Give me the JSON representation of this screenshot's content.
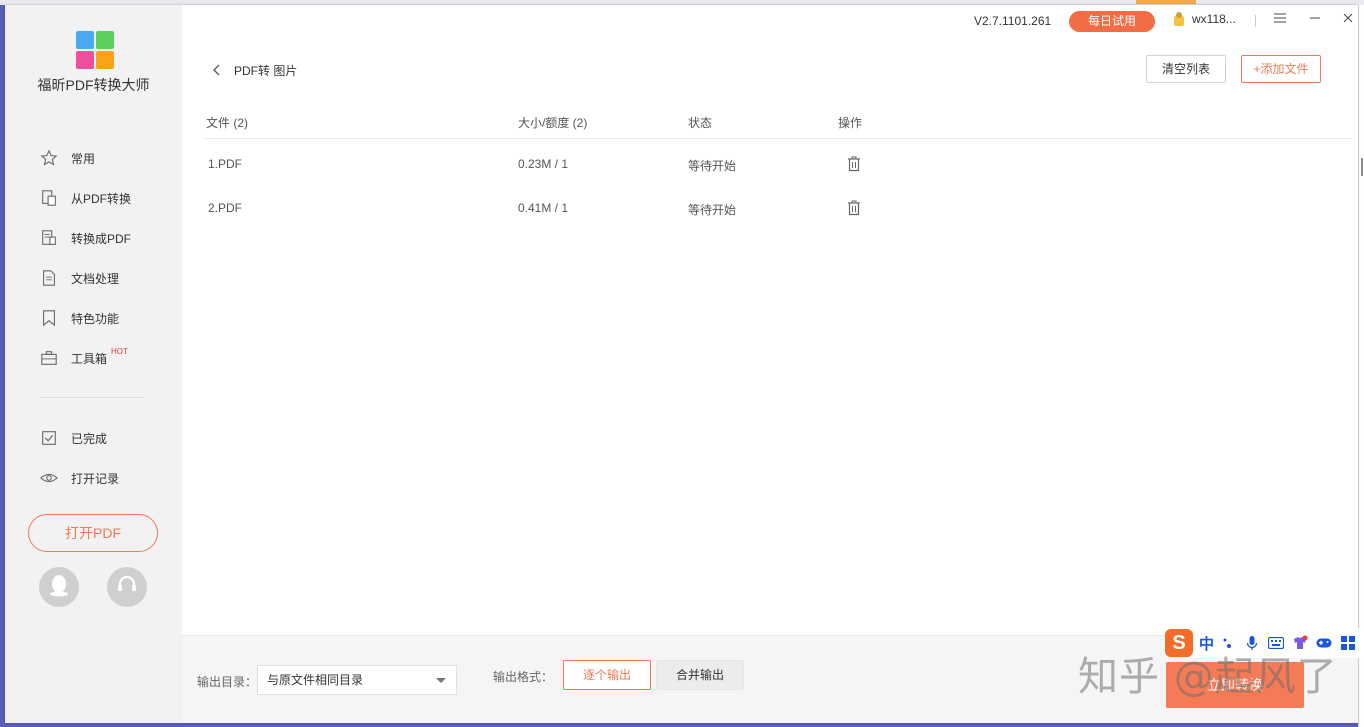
{
  "app": {
    "name": "福昕PDF转换大师",
    "version": "V2.7.1101.261",
    "trial_label": "每日试用",
    "username": "wx118..."
  },
  "sidebar": {
    "items": [
      {
        "label": "常用",
        "icon": "star-icon"
      },
      {
        "label": "从PDF转换",
        "icon": "pdf-convert-icon"
      },
      {
        "label": "转换成PDF",
        "icon": "to-pdf-icon"
      },
      {
        "label": "文档处理",
        "icon": "document-icon"
      },
      {
        "label": "特色功能",
        "icon": "bookmark-icon"
      },
      {
        "label": "工具箱",
        "icon": "toolbox-icon",
        "badge": "HOT"
      },
      {
        "label": "已完成",
        "icon": "check-icon"
      },
      {
        "label": "打开记录",
        "icon": "eye-icon"
      }
    ],
    "open_pdf_label": "打开PDF"
  },
  "main": {
    "breadcrumb": "PDF转 图片",
    "clear_list_label": "清空列表",
    "add_file_label": "+添加文件",
    "columns": {
      "file": "文件 (2)",
      "size": "大小/额度 (2)",
      "status": "状态",
      "action": "操作"
    },
    "rows": [
      {
        "file": "1.PDF",
        "size": "0.23M / 1",
        "status": "等待开始"
      },
      {
        "file": "2.PDF",
        "size": "0.41M / 1",
        "status": "等待开始"
      }
    ]
  },
  "footer": {
    "output_dir_label": "输出目录：",
    "output_dir_value": "与原文件相同目录",
    "output_format_label": "输出格式：",
    "format_options": [
      "逐个输出",
      "合并输出"
    ],
    "selected_format": "逐个输出",
    "start_label": "立即转换"
  },
  "ime": {
    "logo": "S",
    "mode": "中"
  },
  "watermark": "知乎 @起风了",
  "colors": {
    "accent": "#f07a55",
    "trial_bg": "#f26c45",
    "sidebar_bg": "#f2f2f2"
  }
}
